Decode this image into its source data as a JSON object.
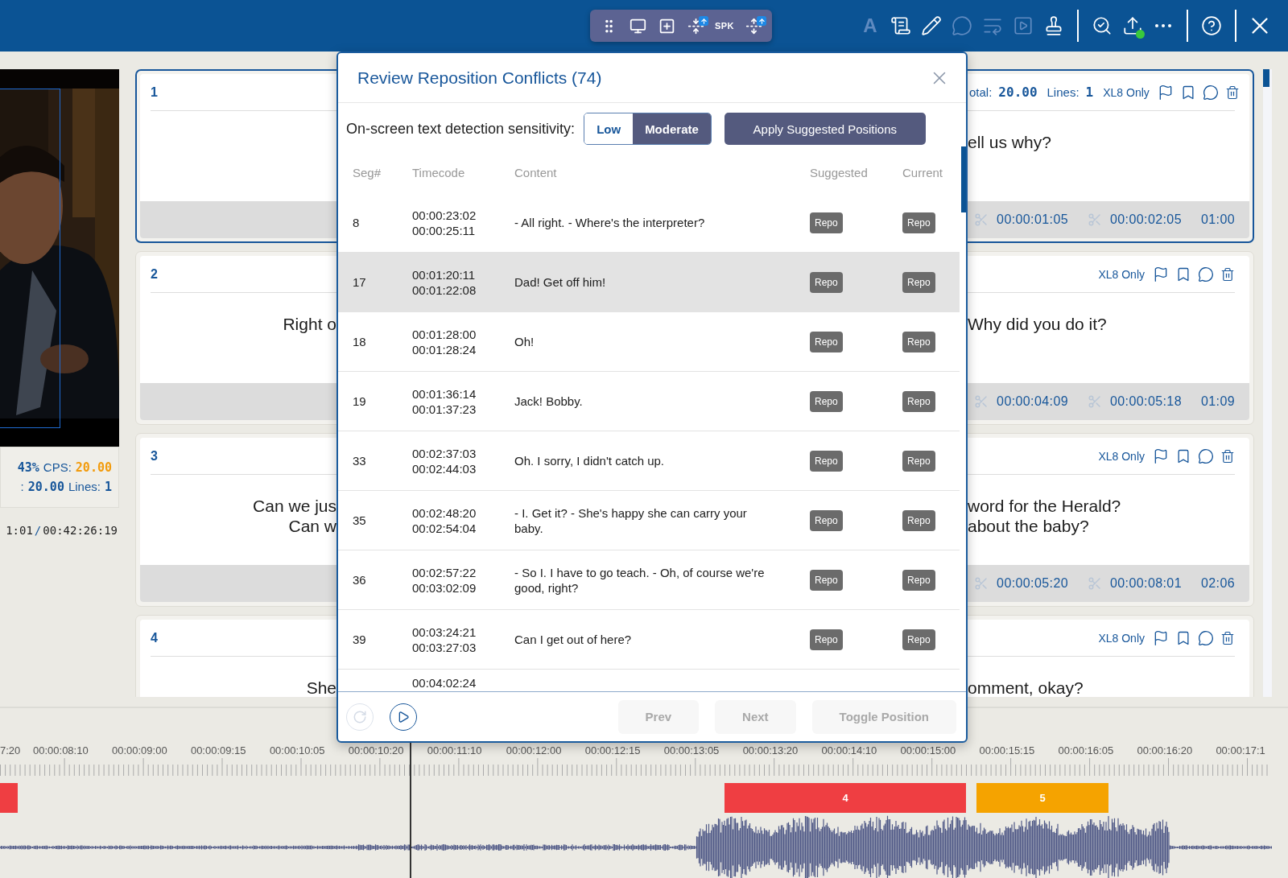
{
  "toolbar": {
    "floating_tools": [
      {
        "kind": "grip",
        "badge": false
      },
      {
        "kind": "add-monitor",
        "badge": false
      },
      {
        "kind": "add-window",
        "badge": false
      },
      {
        "kind": "merge",
        "badge": true
      },
      {
        "kind": "speaker",
        "label": "SPK",
        "badge": false
      },
      {
        "kind": "split",
        "badge": true
      }
    ],
    "tools": [
      {
        "kind": "text",
        "label": "A",
        "disabled": true,
        "dot": false
      },
      {
        "kind": "subtitles",
        "disabled": false,
        "dot": false
      },
      {
        "kind": "pencil",
        "disabled": false,
        "dot": false
      },
      {
        "kind": "comment",
        "disabled": true,
        "dot": false
      },
      {
        "kind": "wrap",
        "disabled": true,
        "dot": false
      },
      {
        "kind": "video",
        "disabled": true,
        "dot": false
      },
      {
        "kind": "stamp",
        "disabled": false,
        "dot": false
      },
      {
        "kind": "divider"
      },
      {
        "kind": "review",
        "disabled": false,
        "dot": false
      },
      {
        "kind": "export",
        "disabled": false,
        "dot": true
      },
      {
        "kind": "more",
        "disabled": false,
        "dot": false
      },
      {
        "kind": "divider"
      },
      {
        "kind": "help",
        "disabled": false,
        "dot": false
      },
      {
        "kind": "divider"
      },
      {
        "kind": "close",
        "disabled": false,
        "dot": false
      }
    ]
  },
  "video": {
    "kind": "picture",
    "stats": [
      [
        {
          "value": "43%",
          "warning": false
        },
        {
          "label": "CPS:",
          "value": "20.00",
          "warning": true
        }
      ],
      [
        {
          "label": ":",
          "value": "20.00",
          "warning": false
        },
        {
          "label": "Lines:",
          "value": "1",
          "warning": false
        }
      ]
    ],
    "timecode": {
      "current": "1:01",
      "separator": "/",
      "total": "00:42:26:19"
    }
  },
  "cards": [
    {
      "number": "1",
      "selected": true,
      "stats": [
        {
          "label": "otal:",
          "value": "20.00"
        },
        {
          "label": "Lines:",
          "value": "1"
        }
      ],
      "tag": "XL8 Only",
      "right_lines": [
        "ell us why?"
      ],
      "start": "00:00:01:05",
      "end": "00:00:02:05",
      "duration": "01:00"
    },
    {
      "number": "2",
      "selected": false,
      "tag": "XL8 Only",
      "left_lines": [
        "Right o"
      ],
      "right_lines": [
        "Why did you do it?"
      ],
      "start": "00:00:04:09",
      "end": "00:00:05:18",
      "duration": "01:09"
    },
    {
      "number": "3",
      "selected": false,
      "tag": "XL8 Only",
      "left_lines": [
        "Can we jus",
        "Can w"
      ],
      "right_lines": [
        "word for the Herald?",
        "about the baby?"
      ],
      "start": "00:00:05:20",
      "end": "00:00:08:01",
      "duration": "02:06"
    },
    {
      "number": "4",
      "selected": false,
      "tag": "XL8 Only",
      "left_lines": [
        "She"
      ],
      "right_lines": [
        "omment, okay?"
      ]
    }
  ],
  "modal": {
    "title": "Review Reposition Conflicts (74)",
    "sensitivity_label": "On-screen text detection sensitivity:",
    "sensitivity_options": [
      {
        "label": "Low",
        "selected": false
      },
      {
        "label": "Moderate",
        "selected": true
      }
    ],
    "apply_button": "Apply Suggested Positions",
    "columns": [
      "Seg#",
      "Timecode",
      "Content",
      "Suggested",
      "Current"
    ],
    "rows": [
      {
        "seg": "8",
        "start": "00:00:23:02",
        "end": "00:00:25:11",
        "content": "- All right. - Where's the interpreter?",
        "suggested": "Repo",
        "current": "Repo",
        "selected": false
      },
      {
        "seg": "17",
        "start": "00:01:20:11",
        "end": "00:01:22:08",
        "content": "Dad! Get off him!",
        "suggested": "Repo",
        "current": "Repo",
        "selected": true
      },
      {
        "seg": "18",
        "start": "00:01:28:00",
        "end": "00:01:28:24",
        "content": "Oh!",
        "suggested": "Repo",
        "current": "Repo",
        "selected": false
      },
      {
        "seg": "19",
        "start": "00:01:36:14",
        "end": "00:01:37:23",
        "content": "Jack! Bobby.",
        "suggested": "Repo",
        "current": "Repo",
        "selected": false
      },
      {
        "seg": "33",
        "start": "00:02:37:03",
        "end": "00:02:44:03",
        "content": "Oh. I sorry, I didn't catch up.",
        "suggested": "Repo",
        "current": "Repo",
        "selected": false
      },
      {
        "seg": "35",
        "start": "00:02:48:20",
        "end": "00:02:54:04",
        "content": "- I. Get it? - She's happy she can carry your baby.",
        "suggested": "Repo",
        "current": "Repo",
        "selected": false
      },
      {
        "seg": "36",
        "start": "00:02:57:22",
        "end": "00:03:02:09",
        "content": "- So I. I have to go teach. - Oh, of course we're good, right?",
        "suggested": "Repo",
        "current": "Repo",
        "selected": false
      },
      {
        "seg": "39",
        "start": "00:03:24:21",
        "end": "00:03:27:03",
        "content": "Can I get out of here?",
        "suggested": "Repo",
        "current": "Repo",
        "selected": false
      }
    ],
    "partial_row": {
      "start": "00:04:02:24"
    },
    "reset_disabled": true,
    "footer_buttons": [
      {
        "label": "Prev",
        "disabled": true
      },
      {
        "label": "Next",
        "disabled": true
      },
      {
        "label": "Toggle Position",
        "disabled": true
      }
    ]
  },
  "timeline": {
    "labels": [
      "7:20",
      "00:00:08:10",
      "00:00:09:00",
      "00:00:09:15",
      "00:00:10:05",
      "00:00:10:20",
      "00:00:11:10",
      "00:00:12:00",
      "00:00:12:15",
      "00:00:13:05",
      "00:00:13:20",
      "00:00:14:10",
      "00:00:15:00",
      "00:00:15:15",
      "00:00:16:05",
      "00:00:16:20",
      "00:00:17:1"
    ],
    "segments": [
      {
        "color": "#ef3e42"
      },
      {
        "label": "4",
        "color": "#ef3e42"
      },
      {
        "label": "5",
        "color": "#f5a300"
      }
    ]
  }
}
